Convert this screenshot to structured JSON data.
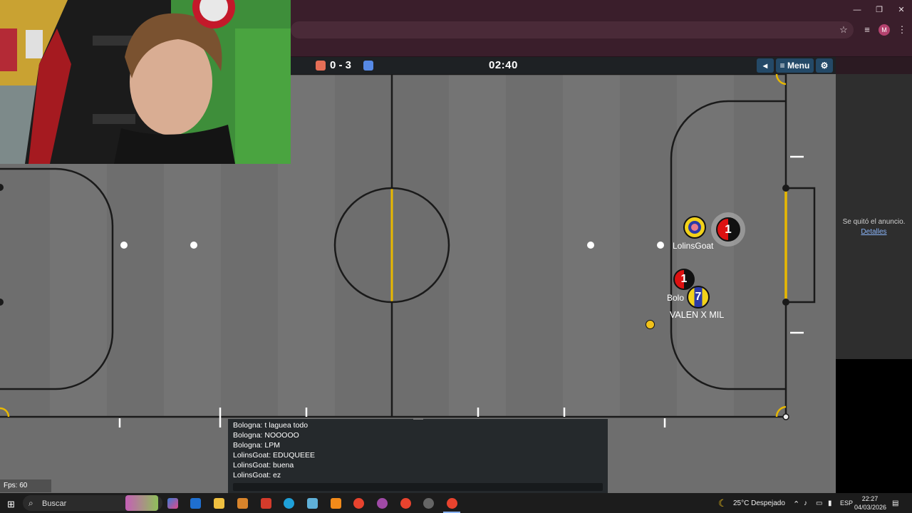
{
  "browser": {
    "window_controls": [
      "—",
      "❐",
      "✕"
    ],
    "profile_initial": "M"
  },
  "hud": {
    "score": "0 - 3",
    "clock": "02:40",
    "menu_label": "Menu",
    "team_colors": {
      "red": "#e56e56",
      "blue": "#5689e5"
    }
  },
  "players": [
    {
      "name": "LolinsGoat",
      "number": "",
      "team": "blue"
    },
    {
      "name": "",
      "number": "1",
      "team": "red"
    },
    {
      "name": "",
      "number": "1",
      "team": "red"
    },
    {
      "name": "Bolo",
      "number": "7",
      "team": "blue"
    },
    {
      "name": "VALEN X MIL",
      "number": "",
      "team": "blue"
    }
  ],
  "chat": [
    "Bologna: t laguea todo",
    "Bologna: NOOOOO",
    "Bologna: LPM",
    "LolinsGoat: EDUQUEEE",
    "LolinsGoat: buena",
    "LolinsGoat: ez"
  ],
  "fps": "Fps: 60",
  "ad": {
    "removed_text": "Se quitó el anuncio.",
    "details_link": "Detalles"
  },
  "taskbar": {
    "search_placeholder": "Buscar",
    "weather": "25°C  Despejado",
    "language": "ESP",
    "time": "22:27",
    "date": "04/03/2026"
  },
  "colors": {
    "field": "#6e6e6e",
    "line": "#1a1a1a",
    "goal_line": "#e8b800",
    "ball": "#f2c21a"
  }
}
